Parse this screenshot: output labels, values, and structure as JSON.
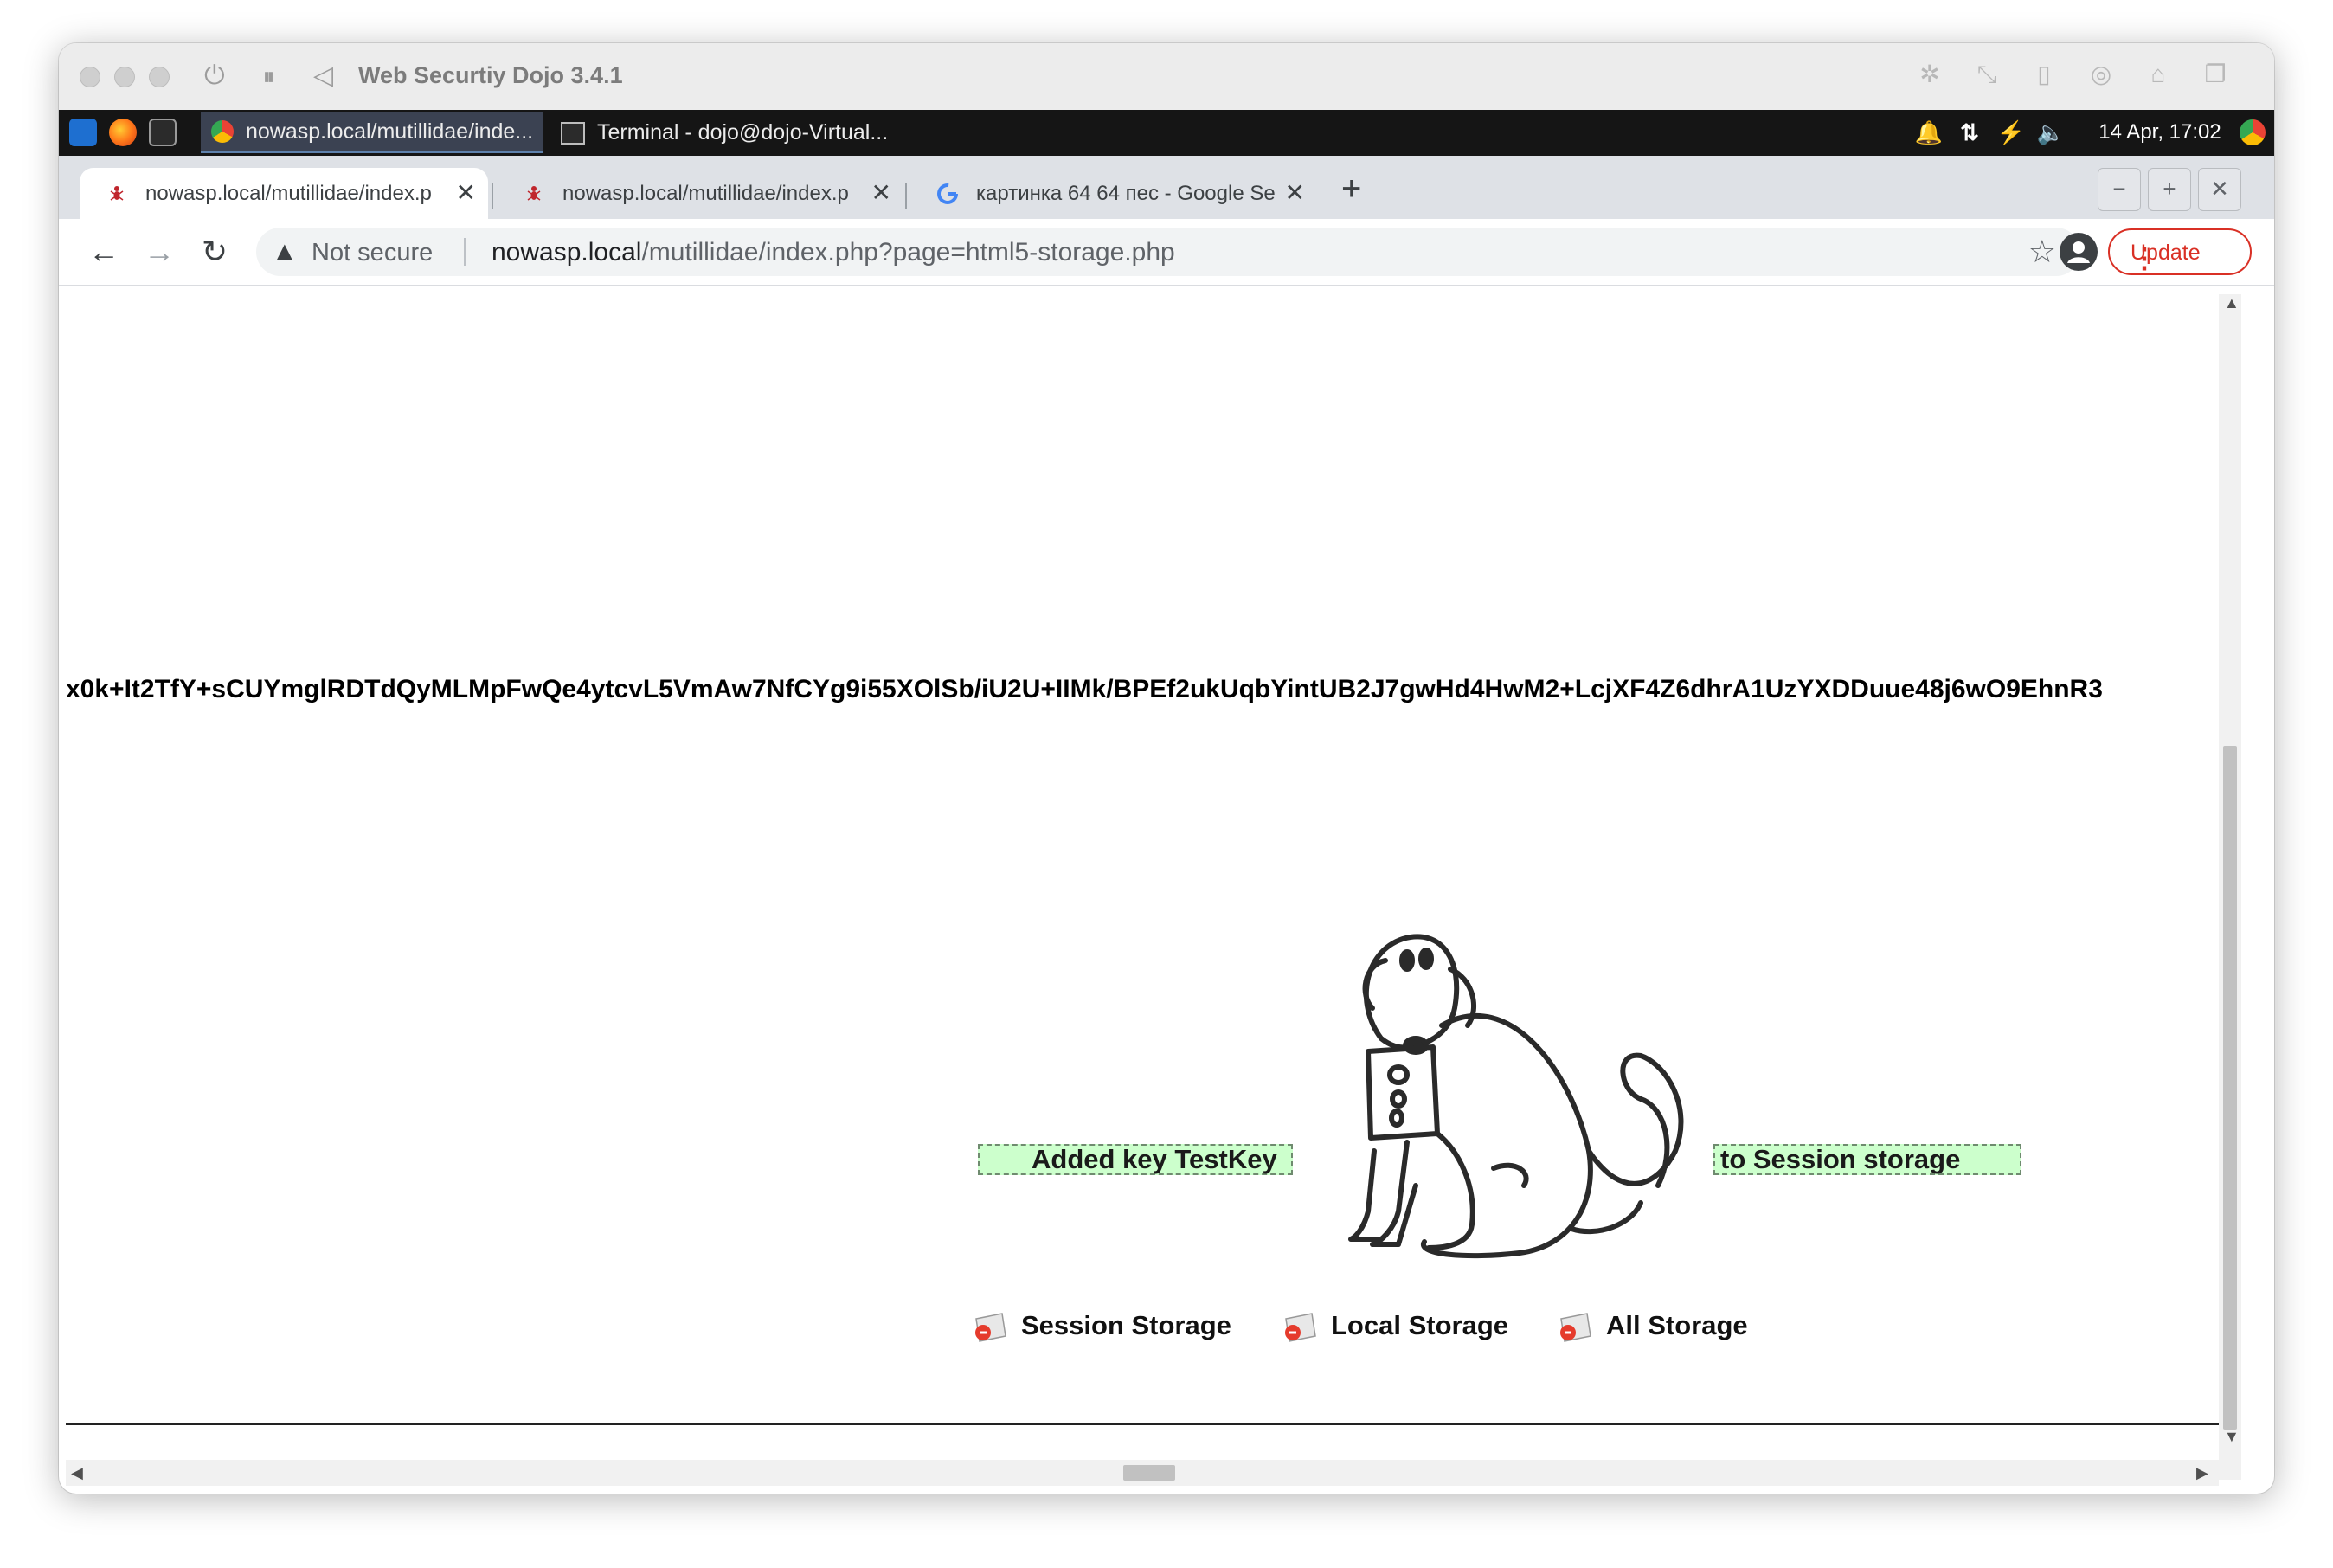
{
  "vm": {
    "title": "Web Securtiy Dojo 3.4.1"
  },
  "panel": {
    "tasks": [
      {
        "label": "nowasp.local/mutillidae/inde..."
      },
      {
        "label": "Terminal - dojo@dojo-Virtual..."
      }
    ],
    "datetime": "14 Apr, 17:02"
  },
  "browser": {
    "tabs": [
      {
        "title": "nowasp.local/mutillidae/index.p"
      },
      {
        "title": "nowasp.local/mutillidae/index.p"
      },
      {
        "title": "картинка 64 64 пес - Google Se"
      }
    ],
    "security_label": "Not secure",
    "url_host": "nowasp.local",
    "url_path": "/mutillidae/index.php?page=html5-storage.php",
    "update_label": "Update"
  },
  "page": {
    "token": "x0k+It2TfY+sCUYmglRDTdQyMLMpFwQe4ytcvL5VmAw7NfCYg9i55XOlSb/iU2U+IIMk/BPEf2ukUqbYintUB2J7gwHd4HwM2+LcjXF4Z6dhrA1UzYXDDuue48j6wO9EhnR3",
    "message_left": "Added key TestKey",
    "message_right": "to Session storage",
    "storage_links": [
      {
        "label": "Session Storage"
      },
      {
        "label": "Local Storage"
      },
      {
        "label": "All Storage"
      }
    ]
  },
  "colors": {
    "message_bg": "#ccffcc",
    "update_red": "#d93025",
    "panel_bg": "#151515"
  }
}
